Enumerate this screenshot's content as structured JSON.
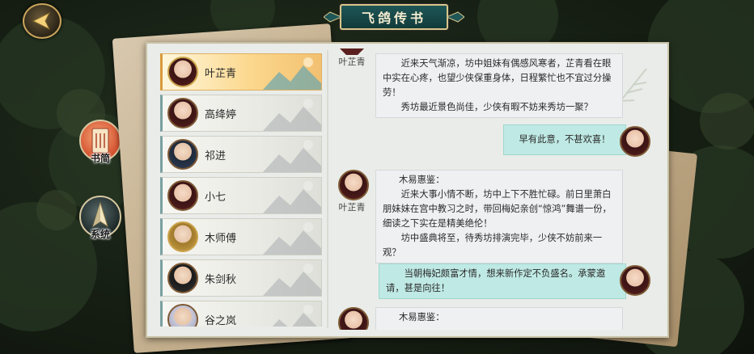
{
  "window": {
    "title": "飞鸽传书"
  },
  "side_buttons": [
    {
      "label": "书简"
    },
    {
      "label": "系统"
    }
  ],
  "contacts": [
    {
      "name": "叶芷青",
      "active": true
    },
    {
      "name": "高绛婷",
      "active": false
    },
    {
      "name": "祁进",
      "active": false
    },
    {
      "name": "小七",
      "active": false
    },
    {
      "name": "木师傅",
      "active": false
    },
    {
      "name": "朱剑秋",
      "active": false
    },
    {
      "name": "谷之岚",
      "active": false
    }
  ],
  "chat": {
    "messages": [
      {
        "direction": "in",
        "sender": "叶芷青",
        "paragraphs": [
          "近来天气渐凉，坊中姐妹有偶感风寒者，芷青看在眼中实在心疼，也望少侠保重身体，日程繁忙也不宜过分操劳！",
          "秀坊最近景色尚佳，少侠有暇不妨来秀坊一聚？"
        ]
      },
      {
        "direction": "out",
        "paragraphs": [
          "早有此意，不甚欢喜！"
        ]
      },
      {
        "direction": "in",
        "sender": "叶芷青",
        "salutation": "木易惠鉴：",
        "paragraphs": [
          "近来大事小情不断，坊中上下不胜忙碌。前日里萧白朋妹妹在宫中教习之时，带回梅妃亲创“惊鸿”舞谱一份，细读之下实在是精美绝伦！",
          "坊中盛典将至，待秀坊排演完毕，少侠不妨前来一观？"
        ]
      },
      {
        "direction": "out",
        "paragraphs": [
          "当朝梅妃颇富才情，想来新作定不负盛名。承蒙邀请，甚是向往！"
        ]
      },
      {
        "direction": "in",
        "sender": "叶芷青",
        "salutation": "木易惠鉴："
      }
    ]
  },
  "colors": {
    "panel_bg": "#e9ece8",
    "active_contact": "#fbd88e",
    "outgoing_bubble": "#bfe9e4",
    "incoming_bubble": "#eef0f2",
    "title_plate": "#1f5656"
  }
}
